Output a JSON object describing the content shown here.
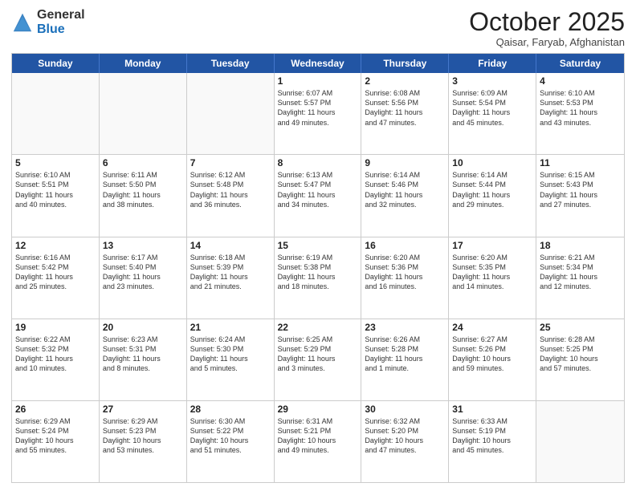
{
  "header": {
    "logo_general": "General",
    "logo_blue": "Blue",
    "month_title": "October 2025",
    "location": "Qaisar, Faryab, Afghanistan"
  },
  "calendar": {
    "days_of_week": [
      "Sunday",
      "Monday",
      "Tuesday",
      "Wednesday",
      "Thursday",
      "Friday",
      "Saturday"
    ],
    "weeks": [
      [
        {
          "day": "",
          "info": ""
        },
        {
          "day": "",
          "info": ""
        },
        {
          "day": "",
          "info": ""
        },
        {
          "day": "1",
          "info": "Sunrise: 6:07 AM\nSunset: 5:57 PM\nDaylight: 11 hours\nand 49 minutes."
        },
        {
          "day": "2",
          "info": "Sunrise: 6:08 AM\nSunset: 5:56 PM\nDaylight: 11 hours\nand 47 minutes."
        },
        {
          "day": "3",
          "info": "Sunrise: 6:09 AM\nSunset: 5:54 PM\nDaylight: 11 hours\nand 45 minutes."
        },
        {
          "day": "4",
          "info": "Sunrise: 6:10 AM\nSunset: 5:53 PM\nDaylight: 11 hours\nand 43 minutes."
        }
      ],
      [
        {
          "day": "5",
          "info": "Sunrise: 6:10 AM\nSunset: 5:51 PM\nDaylight: 11 hours\nand 40 minutes."
        },
        {
          "day": "6",
          "info": "Sunrise: 6:11 AM\nSunset: 5:50 PM\nDaylight: 11 hours\nand 38 minutes."
        },
        {
          "day": "7",
          "info": "Sunrise: 6:12 AM\nSunset: 5:48 PM\nDaylight: 11 hours\nand 36 minutes."
        },
        {
          "day": "8",
          "info": "Sunrise: 6:13 AM\nSunset: 5:47 PM\nDaylight: 11 hours\nand 34 minutes."
        },
        {
          "day": "9",
          "info": "Sunrise: 6:14 AM\nSunset: 5:46 PM\nDaylight: 11 hours\nand 32 minutes."
        },
        {
          "day": "10",
          "info": "Sunrise: 6:14 AM\nSunset: 5:44 PM\nDaylight: 11 hours\nand 29 minutes."
        },
        {
          "day": "11",
          "info": "Sunrise: 6:15 AM\nSunset: 5:43 PM\nDaylight: 11 hours\nand 27 minutes."
        }
      ],
      [
        {
          "day": "12",
          "info": "Sunrise: 6:16 AM\nSunset: 5:42 PM\nDaylight: 11 hours\nand 25 minutes."
        },
        {
          "day": "13",
          "info": "Sunrise: 6:17 AM\nSunset: 5:40 PM\nDaylight: 11 hours\nand 23 minutes."
        },
        {
          "day": "14",
          "info": "Sunrise: 6:18 AM\nSunset: 5:39 PM\nDaylight: 11 hours\nand 21 minutes."
        },
        {
          "day": "15",
          "info": "Sunrise: 6:19 AM\nSunset: 5:38 PM\nDaylight: 11 hours\nand 18 minutes."
        },
        {
          "day": "16",
          "info": "Sunrise: 6:20 AM\nSunset: 5:36 PM\nDaylight: 11 hours\nand 16 minutes."
        },
        {
          "day": "17",
          "info": "Sunrise: 6:20 AM\nSunset: 5:35 PM\nDaylight: 11 hours\nand 14 minutes."
        },
        {
          "day": "18",
          "info": "Sunrise: 6:21 AM\nSunset: 5:34 PM\nDaylight: 11 hours\nand 12 minutes."
        }
      ],
      [
        {
          "day": "19",
          "info": "Sunrise: 6:22 AM\nSunset: 5:32 PM\nDaylight: 11 hours\nand 10 minutes."
        },
        {
          "day": "20",
          "info": "Sunrise: 6:23 AM\nSunset: 5:31 PM\nDaylight: 11 hours\nand 8 minutes."
        },
        {
          "day": "21",
          "info": "Sunrise: 6:24 AM\nSunset: 5:30 PM\nDaylight: 11 hours\nand 5 minutes."
        },
        {
          "day": "22",
          "info": "Sunrise: 6:25 AM\nSunset: 5:29 PM\nDaylight: 11 hours\nand 3 minutes."
        },
        {
          "day": "23",
          "info": "Sunrise: 6:26 AM\nSunset: 5:28 PM\nDaylight: 11 hours\nand 1 minute."
        },
        {
          "day": "24",
          "info": "Sunrise: 6:27 AM\nSunset: 5:26 PM\nDaylight: 10 hours\nand 59 minutes."
        },
        {
          "day": "25",
          "info": "Sunrise: 6:28 AM\nSunset: 5:25 PM\nDaylight: 10 hours\nand 57 minutes."
        }
      ],
      [
        {
          "day": "26",
          "info": "Sunrise: 6:29 AM\nSunset: 5:24 PM\nDaylight: 10 hours\nand 55 minutes."
        },
        {
          "day": "27",
          "info": "Sunrise: 6:29 AM\nSunset: 5:23 PM\nDaylight: 10 hours\nand 53 minutes."
        },
        {
          "day": "28",
          "info": "Sunrise: 6:30 AM\nSunset: 5:22 PM\nDaylight: 10 hours\nand 51 minutes."
        },
        {
          "day": "29",
          "info": "Sunrise: 6:31 AM\nSunset: 5:21 PM\nDaylight: 10 hours\nand 49 minutes."
        },
        {
          "day": "30",
          "info": "Sunrise: 6:32 AM\nSunset: 5:20 PM\nDaylight: 10 hours\nand 47 minutes."
        },
        {
          "day": "31",
          "info": "Sunrise: 6:33 AM\nSunset: 5:19 PM\nDaylight: 10 hours\nand 45 minutes."
        },
        {
          "day": "",
          "info": ""
        }
      ]
    ]
  }
}
